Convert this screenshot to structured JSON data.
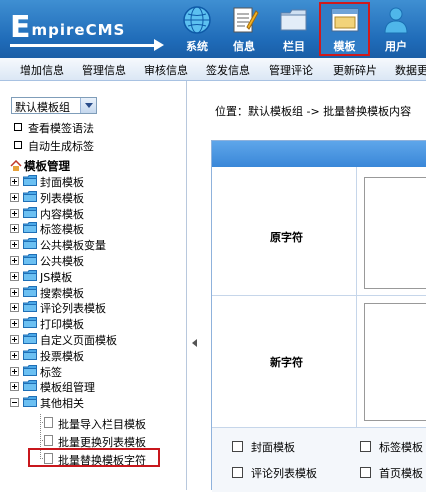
{
  "header": {
    "logo_initial": "E",
    "logo_rest": "mpireCMS",
    "nav": [
      {
        "label": "系统",
        "icon": "globe-icon"
      },
      {
        "label": "信息",
        "icon": "document-icon"
      },
      {
        "label": "栏目",
        "icon": "folder-icon"
      },
      {
        "label": "模板",
        "icon": "window-icon",
        "active": true
      },
      {
        "label": "用户",
        "icon": "user-icon"
      }
    ]
  },
  "submenu": [
    "增加信息",
    "管理信息",
    "审核信息",
    "签发信息",
    "管理评论",
    "更新碎片",
    "数据更"
  ],
  "left": {
    "select_value": "默认模板组",
    "links": [
      "查看模签语法",
      "自动生成标签"
    ],
    "root": "模板管理",
    "tree": [
      "封面模板",
      "列表模板",
      "内容模板",
      "标签模板",
      "公共模板变量",
      "公共模板",
      "JS模板",
      "搜索模板",
      "评论列表模板",
      "打印模板",
      "自定义页面模板",
      "投票模板",
      "标签",
      "模板组管理",
      "其他相关"
    ],
    "children": [
      "批量导入栏目模板",
      "批量更换列表模板",
      "批量替换模板字符"
    ]
  },
  "content": {
    "breadcrumb": "位置：默认模板组 -> 批量替换模板内容",
    "old_label": "原字符",
    "new_label": "新字符",
    "checkboxes": [
      "封面模板",
      "标签模板",
      "评论列表模板",
      "首页模板"
    ]
  },
  "colors": {
    "header_blue": "#1f6bb8",
    "active_border": "#c8171c",
    "content_bar": "#3a87d8"
  }
}
